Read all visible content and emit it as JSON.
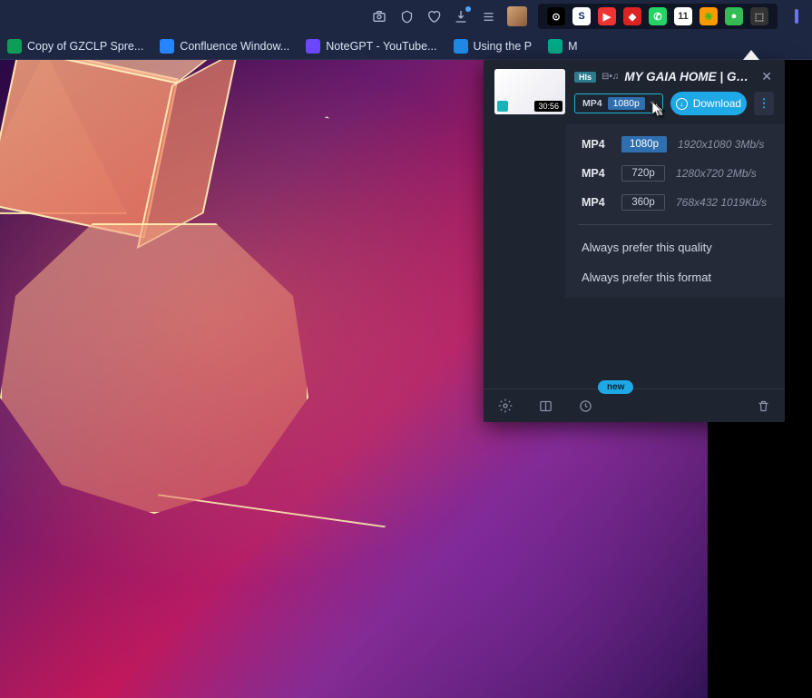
{
  "chrome_icons": [
    "camera",
    "shield",
    "heart",
    "download",
    "list"
  ],
  "extensions": [
    {
      "bg": "#000",
      "fg": "#fff",
      "ch": "⊙"
    },
    {
      "bg": "#fff",
      "fg": "#0a2f6b",
      "ch": "S"
    },
    {
      "bg": "#e33",
      "fg": "#fff",
      "ch": "▶"
    },
    {
      "bg": "#d22",
      "fg": "#fff",
      "ch": "◆"
    },
    {
      "bg": "#25d366",
      "fg": "#fff",
      "ch": "✆"
    },
    {
      "bg": "#fff",
      "fg": "#333",
      "ch": "11"
    },
    {
      "bg": "#f90",
      "fg": "#4b2",
      "ch": "❋"
    },
    {
      "bg": "#3b5",
      "fg": "#fff",
      "ch": "●"
    },
    {
      "bg": "#333",
      "fg": "#bbb",
      "ch": "⬚"
    }
  ],
  "bookmarks": [
    {
      "fav": "#0d9d58",
      "label": "Copy of GZCLP Spre..."
    },
    {
      "fav": "#2684ff",
      "label": "Confluence Window..."
    },
    {
      "fav": "#6b46ff",
      "label": "NoteGPT - YouTube..."
    },
    {
      "fav": "#1e88e5",
      "label": "Using the P"
    },
    {
      "fav": "#0a8",
      "label": "M"
    }
  ],
  "thumb_time": "30:56",
  "hls_badge": "Hls",
  "video_title": "MY GAIA HOME | GAIA",
  "selector": {
    "format": "MP4",
    "quality": "1080p"
  },
  "download_label": "Download",
  "qualities": [
    {
      "format": "MP4",
      "quality": "1080p",
      "detail": "1920x1080 3Mb/s",
      "selected": true
    },
    {
      "format": "MP4",
      "quality": "720p",
      "detail": "1280x720 2Mb/s",
      "selected": false
    },
    {
      "format": "MP4",
      "quality": "360p",
      "detail": "768x432 1019Kb/s",
      "selected": false
    }
  ],
  "pref_quality": "Always prefer this quality",
  "pref_format": "Always prefer this format",
  "new_badge": "new"
}
